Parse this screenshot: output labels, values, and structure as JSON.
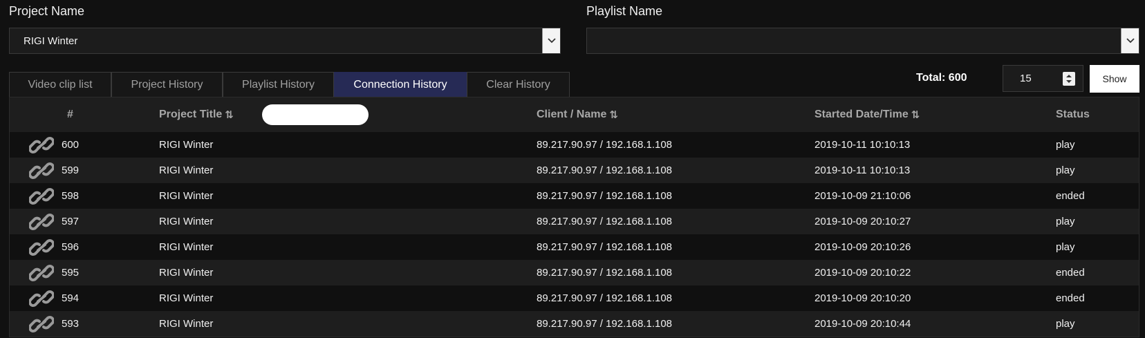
{
  "project": {
    "label": "Project Name",
    "selected": "RIGI Winter"
  },
  "playlist": {
    "label": "Playlist Name",
    "selected": ""
  },
  "tabs": [
    {
      "label": "Video clip list",
      "active": false
    },
    {
      "label": "Project History",
      "active": false
    },
    {
      "label": "Playlist History",
      "active": false
    },
    {
      "label": "Connection History",
      "active": true
    },
    {
      "label": "Clear History",
      "active": false
    }
  ],
  "pager": {
    "total_label": "Total: 600",
    "page_size": "15",
    "show_label": "Show"
  },
  "table": {
    "headers": {
      "number": "#",
      "project_title": "Project Title",
      "client_name": "Client / Name",
      "started": "Started Date/Time",
      "status": "Status"
    },
    "rows": [
      {
        "number": "600",
        "project_title": "RIGI Winter",
        "client_name": "89.217.90.97 / 192.168.1.108",
        "started": "2019-10-11 10:10:13",
        "status": "play"
      },
      {
        "number": "599",
        "project_title": "RIGI Winter",
        "client_name": "89.217.90.97 / 192.168.1.108",
        "started": "2019-10-11 10:10:13",
        "status": "play"
      },
      {
        "number": "598",
        "project_title": "RIGI Winter",
        "client_name": "89.217.90.97 / 192.168.1.108",
        "started": "2019-10-09 21:10:06",
        "status": "ended"
      },
      {
        "number": "597",
        "project_title": "RIGI Winter",
        "client_name": "89.217.90.97 / 192.168.1.108",
        "started": "2019-10-09 20:10:27",
        "status": "play"
      },
      {
        "number": "596",
        "project_title": "RIGI Winter",
        "client_name": "89.217.90.97 / 192.168.1.108",
        "started": "2019-10-09 20:10:26",
        "status": "play"
      },
      {
        "number": "595",
        "project_title": "RIGI Winter",
        "client_name": "89.217.90.97 / 192.168.1.108",
        "started": "2019-10-09 20:10:22",
        "status": "ended"
      },
      {
        "number": "594",
        "project_title": "RIGI Winter",
        "client_name": "89.217.90.97 / 192.168.1.108",
        "started": "2019-10-09 20:10:20",
        "status": "ended"
      },
      {
        "number": "593",
        "project_title": "RIGI Winter",
        "client_name": "89.217.90.97 / 192.168.1.108",
        "started": "2019-10-09 20:10:44",
        "status": "play"
      }
    ]
  },
  "colors": {
    "background": "#111111",
    "active_tab": "#262a55",
    "row_alt": "#1e1e1e"
  },
  "icons": {
    "row_icon": "chain-link-icon",
    "sort_icon": "sort-arrows-icon",
    "dropdown_icon": "chevron-down-icon"
  }
}
